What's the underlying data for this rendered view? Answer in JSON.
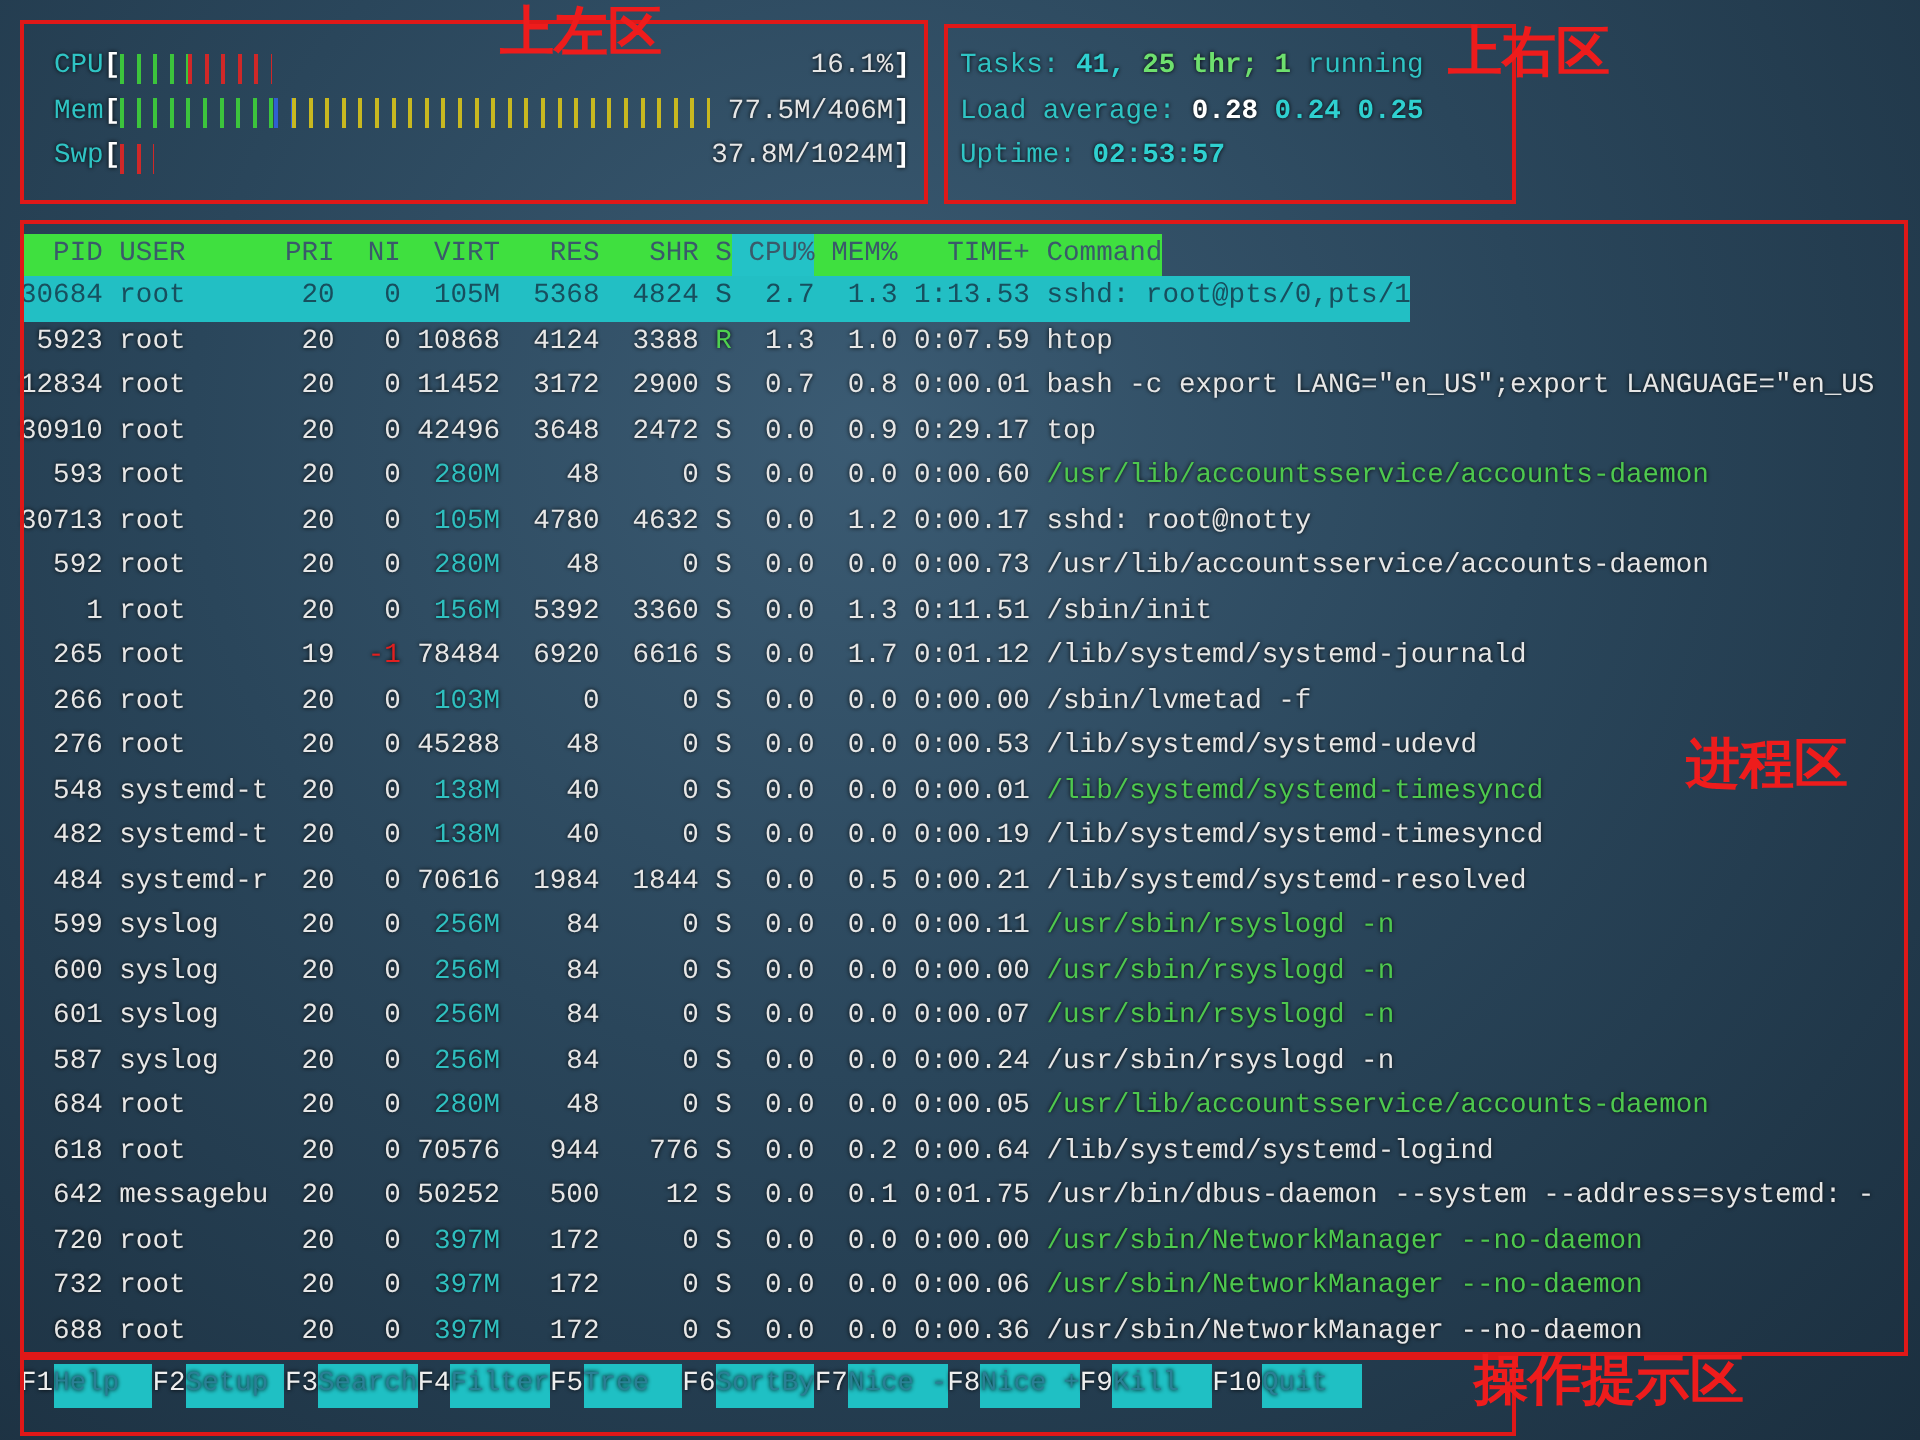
{
  "meters": [
    {
      "label": "CPU",
      "open": "[",
      "close": "]",
      "value": "16.1%",
      "segments": [
        {
          "color": "#3cc43c",
          "level": 0.087
        },
        {
          "color": "#d02828",
          "level": 0.109
        }
      ]
    },
    {
      "label": "Mem",
      "open": "[",
      "close": "]",
      "value": "77.5M/406M",
      "segments": [
        {
          "color": "#3cc43c",
          "level": 0.2
        },
        {
          "color": "#2f5fd0",
          "level": 0.022
        },
        {
          "color": "#c8b820",
          "level": 0.54
        }
      ]
    },
    {
      "label": "Swp",
      "open": "[",
      "close": "]",
      "value": "37.8M/1024M",
      "segments": [
        {
          "color": "#d02828",
          "level": 0.043
        }
      ]
    }
  ],
  "summary": [
    {
      "parts": [
        {
          "text": "Tasks:",
          "kind": "label"
        },
        {
          "text": "41,",
          "kind": "value"
        },
        {
          "text": "25",
          "kind": "accent"
        },
        {
          "text": "thr;",
          "kind": "accent"
        },
        {
          "text": "1",
          "kind": "accent"
        },
        {
          "text": "running",
          "kind": "label"
        }
      ]
    },
    {
      "parts": [
        {
          "text": "Load average:",
          "kind": "label"
        },
        {
          "text": "0.28",
          "kind": "bright"
        },
        {
          "text": "0.24",
          "kind": "value"
        },
        {
          "text": "0.25",
          "kind": "value"
        }
      ]
    },
    {
      "parts": [
        {
          "text": "Uptime:",
          "kind": "label"
        },
        {
          "text": "02:53:57",
          "kind": "value"
        }
      ]
    }
  ],
  "table": {
    "columns": [
      {
        "label": "PID",
        "sorted": false
      },
      {
        "label": "USER",
        "sorted": false
      },
      {
        "label": "PRI",
        "sorted": false
      },
      {
        "label": "NI",
        "sorted": false
      },
      {
        "label": "VIRT",
        "sorted": false
      },
      {
        "label": "RES",
        "sorted": false
      },
      {
        "label": "SHR",
        "sorted": false
      },
      {
        "label": "S",
        "sorted": false
      },
      {
        "label": "CPU%",
        "sorted": true
      },
      {
        "label": "MEM%",
        "sorted": false
      },
      {
        "label": "TIME+",
        "sorted": false
      },
      {
        "label": "Command",
        "sorted": false
      }
    ],
    "rows": [
      {
        "pid": "30684",
        "user": "root",
        "pri": "20",
        "ni": "0",
        "virt": "105M",
        "res": "5368",
        "shr": "4824",
        "state": "S",
        "cpu": "2.7",
        "mem": "1.3",
        "time": "1:13.53",
        "command": "sshd: root@pts/0,pts/1",
        "selected": true,
        "running": false,
        "thread": false
      },
      {
        "pid": "5923",
        "user": "root",
        "pri": "20",
        "ni": "0",
        "virt": "10868",
        "res": "4124",
        "shr": "3388",
        "state": "R",
        "cpu": "1.3",
        "mem": "1.0",
        "time": "0:07.59",
        "command": "htop",
        "selected": false,
        "running": true,
        "thread": false
      },
      {
        "pid": "12834",
        "user": "root",
        "pri": "20",
        "ni": "0",
        "virt": "11452",
        "res": "3172",
        "shr": "2900",
        "state": "S",
        "cpu": "0.7",
        "mem": "0.8",
        "time": "0:00.01",
        "command": "bash -c export LANG=\"en_US\";export LANGUAGE=\"en_US",
        "selected": false,
        "running": false,
        "thread": false
      },
      {
        "pid": "30910",
        "user": "root",
        "pri": "20",
        "ni": "0",
        "virt": "42496",
        "res": "3648",
        "shr": "2472",
        "state": "S",
        "cpu": "0.0",
        "mem": "0.9",
        "time": "0:29.17",
        "command": "top",
        "selected": false,
        "running": false,
        "thread": false
      },
      {
        "pid": "593",
        "user": "root",
        "pri": "20",
        "ni": "0",
        "virt": "280M",
        "res": "48",
        "shr": "0",
        "state": "S",
        "cpu": "0.0",
        "mem": "0.0",
        "time": "0:00.60",
        "command": "/usr/lib/accountsservice/accounts-daemon",
        "selected": false,
        "running": false,
        "thread": true
      },
      {
        "pid": "30713",
        "user": "root",
        "pri": "20",
        "ni": "0",
        "virt": "105M",
        "res": "4780",
        "shr": "4632",
        "state": "S",
        "cpu": "0.0",
        "mem": "1.2",
        "time": "0:00.17",
        "command": "sshd: root@notty",
        "selected": false,
        "running": false,
        "thread": false
      },
      {
        "pid": "592",
        "user": "root",
        "pri": "20",
        "ni": "0",
        "virt": "280M",
        "res": "48",
        "shr": "0",
        "state": "S",
        "cpu": "0.0",
        "mem": "0.0",
        "time": "0:00.73",
        "command": "/usr/lib/accountsservice/accounts-daemon",
        "selected": false,
        "running": false,
        "thread": false
      },
      {
        "pid": "1",
        "user": "root",
        "pri": "20",
        "ni": "0",
        "virt": "156M",
        "res": "5392",
        "shr": "3360",
        "state": "S",
        "cpu": "0.0",
        "mem": "1.3",
        "time": "0:11.51",
        "command": "/sbin/init",
        "selected": false,
        "running": false,
        "thread": false
      },
      {
        "pid": "265",
        "user": "root",
        "pri": "19",
        "ni": "-1",
        "virt": "78484",
        "res": "6920",
        "shr": "6616",
        "state": "S",
        "cpu": "0.0",
        "mem": "1.7",
        "time": "0:01.12",
        "command": "/lib/systemd/systemd-journald",
        "selected": false,
        "running": false,
        "thread": false
      },
      {
        "pid": "266",
        "user": "root",
        "pri": "20",
        "ni": "0",
        "virt": "103M",
        "res": "0",
        "shr": "0",
        "state": "S",
        "cpu": "0.0",
        "mem": "0.0",
        "time": "0:00.00",
        "command": "/sbin/lvmetad -f",
        "selected": false,
        "running": false,
        "thread": false
      },
      {
        "pid": "276",
        "user": "root",
        "pri": "20",
        "ni": "0",
        "virt": "45288",
        "res": "48",
        "shr": "0",
        "state": "S",
        "cpu": "0.0",
        "mem": "0.0",
        "time": "0:00.53",
        "command": "/lib/systemd/systemd-udevd",
        "selected": false,
        "running": false,
        "thread": false
      },
      {
        "pid": "548",
        "user": "systemd-t",
        "pri": "20",
        "ni": "0",
        "virt": "138M",
        "res": "40",
        "shr": "0",
        "state": "S",
        "cpu": "0.0",
        "mem": "0.0",
        "time": "0:00.01",
        "command": "/lib/systemd/systemd-timesyncd",
        "selected": false,
        "running": false,
        "thread": true
      },
      {
        "pid": "482",
        "user": "systemd-t",
        "pri": "20",
        "ni": "0",
        "virt": "138M",
        "res": "40",
        "shr": "0",
        "state": "S",
        "cpu": "0.0",
        "mem": "0.0",
        "time": "0:00.19",
        "command": "/lib/systemd/systemd-timesyncd",
        "selected": false,
        "running": false,
        "thread": false
      },
      {
        "pid": "484",
        "user": "systemd-r",
        "pri": "20",
        "ni": "0",
        "virt": "70616",
        "res": "1984",
        "shr": "1844",
        "state": "S",
        "cpu": "0.0",
        "mem": "0.5",
        "time": "0:00.21",
        "command": "/lib/systemd/systemd-resolved",
        "selected": false,
        "running": false,
        "thread": false
      },
      {
        "pid": "599",
        "user": "syslog",
        "pri": "20",
        "ni": "0",
        "virt": "256M",
        "res": "84",
        "shr": "0",
        "state": "S",
        "cpu": "0.0",
        "mem": "0.0",
        "time": "0:00.11",
        "command": "/usr/sbin/rsyslogd -n",
        "selected": false,
        "running": false,
        "thread": true
      },
      {
        "pid": "600",
        "user": "syslog",
        "pri": "20",
        "ni": "0",
        "virt": "256M",
        "res": "84",
        "shr": "0",
        "state": "S",
        "cpu": "0.0",
        "mem": "0.0",
        "time": "0:00.00",
        "command": "/usr/sbin/rsyslogd -n",
        "selected": false,
        "running": false,
        "thread": true
      },
      {
        "pid": "601",
        "user": "syslog",
        "pri": "20",
        "ni": "0",
        "virt": "256M",
        "res": "84",
        "shr": "0",
        "state": "S",
        "cpu": "0.0",
        "mem": "0.0",
        "time": "0:00.07",
        "command": "/usr/sbin/rsyslogd -n",
        "selected": false,
        "running": false,
        "thread": true
      },
      {
        "pid": "587",
        "user": "syslog",
        "pri": "20",
        "ni": "0",
        "virt": "256M",
        "res": "84",
        "shr": "0",
        "state": "S",
        "cpu": "0.0",
        "mem": "0.0",
        "time": "0:00.24",
        "command": "/usr/sbin/rsyslogd -n",
        "selected": false,
        "running": false,
        "thread": false
      },
      {
        "pid": "684",
        "user": "root",
        "pri": "20",
        "ni": "0",
        "virt": "280M",
        "res": "48",
        "shr": "0",
        "state": "S",
        "cpu": "0.0",
        "mem": "0.0",
        "time": "0:00.05",
        "command": "/usr/lib/accountsservice/accounts-daemon",
        "selected": false,
        "running": false,
        "thread": true
      },
      {
        "pid": "618",
        "user": "root",
        "pri": "20",
        "ni": "0",
        "virt": "70576",
        "res": "944",
        "shr": "776",
        "state": "S",
        "cpu": "0.0",
        "mem": "0.2",
        "time": "0:00.64",
        "command": "/lib/systemd/systemd-logind",
        "selected": false,
        "running": false,
        "thread": false
      },
      {
        "pid": "642",
        "user": "messagebu",
        "pri": "20",
        "ni": "0",
        "virt": "50252",
        "res": "500",
        "shr": "12",
        "state": "S",
        "cpu": "0.0",
        "mem": "0.1",
        "time": "0:01.75",
        "command": "/usr/bin/dbus-daemon --system --address=systemd: -",
        "selected": false,
        "running": false,
        "thread": false
      },
      {
        "pid": "720",
        "user": "root",
        "pri": "20",
        "ni": "0",
        "virt": "397M",
        "res": "172",
        "shr": "0",
        "state": "S",
        "cpu": "0.0",
        "mem": "0.0",
        "time": "0:00.00",
        "command": "/usr/sbin/NetworkManager --no-daemon",
        "selected": false,
        "running": false,
        "thread": true
      },
      {
        "pid": "732",
        "user": "root",
        "pri": "20",
        "ni": "0",
        "virt": "397M",
        "res": "172",
        "shr": "0",
        "state": "S",
        "cpu": "0.0",
        "mem": "0.0",
        "time": "0:00.06",
        "command": "/usr/sbin/NetworkManager --no-daemon",
        "selected": false,
        "running": false,
        "thread": true
      },
      {
        "pid": "688",
        "user": "root",
        "pri": "20",
        "ni": "0",
        "virt": "397M",
        "res": "172",
        "shr": "0",
        "state": "S",
        "cpu": "0.0",
        "mem": "0.0",
        "time": "0:00.36",
        "command": "/usr/sbin/NetworkManager --no-daemon",
        "selected": false,
        "running": false,
        "thread": false
      }
    ]
  },
  "function_keys": [
    {
      "key": "F1",
      "label": "Help"
    },
    {
      "key": "F2",
      "label": "Setup"
    },
    {
      "key": "F3",
      "label": "Search"
    },
    {
      "key": "F4",
      "label": "Filter"
    },
    {
      "key": "F5",
      "label": "Tree"
    },
    {
      "key": "F6",
      "label": "SortBy"
    },
    {
      "key": "F7",
      "label": "Nice -"
    },
    {
      "key": "F8",
      "label": "Nice +"
    },
    {
      "key": "F9",
      "label": "Kill"
    },
    {
      "key": "F10",
      "label": "Quit"
    }
  ],
  "annotations": [
    {
      "text": "上左区"
    },
    {
      "text": "上右区"
    },
    {
      "text": "进程区"
    },
    {
      "text": "操作提示区"
    }
  ]
}
